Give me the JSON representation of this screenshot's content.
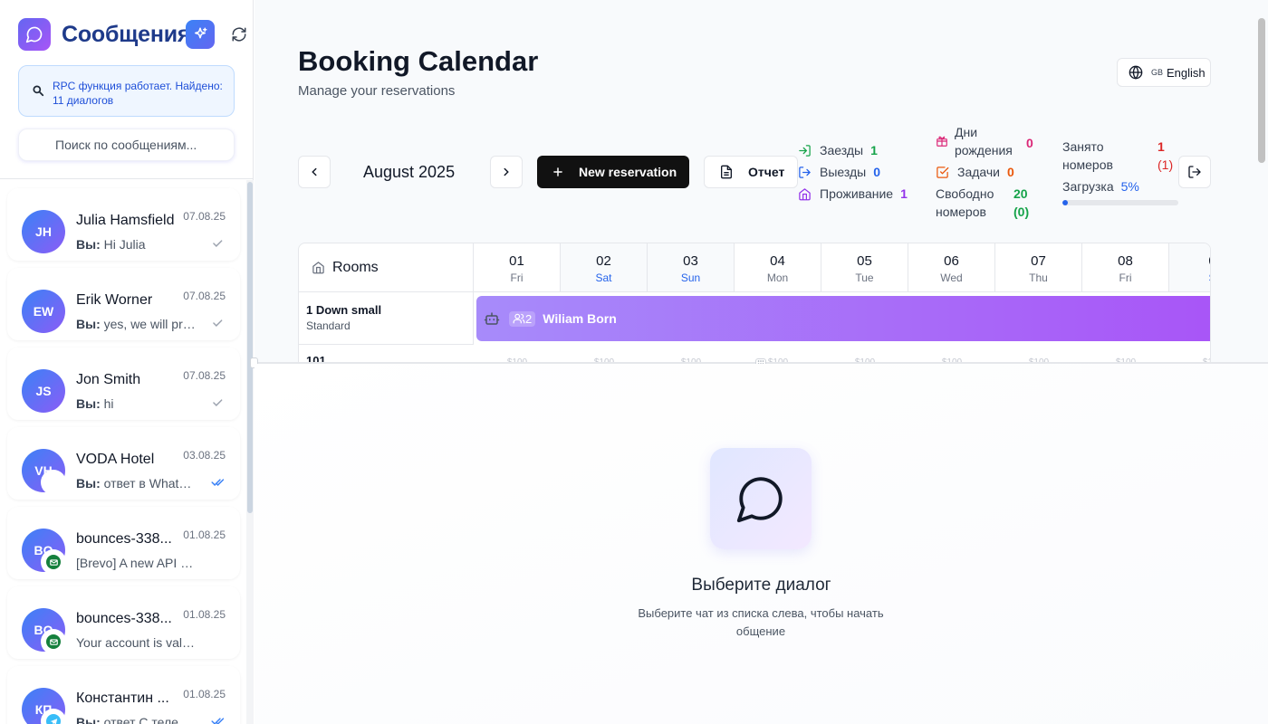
{
  "sidebar": {
    "app_title": "Сообщения",
    "rpc_status": "RPC функция работает. Найдено: 11 диалогов",
    "search_placeholder": "Поиск по сообщениям...",
    "chats": [
      {
        "initials": "JH",
        "name": "Julia Hamsfield",
        "date": "07.08.25",
        "sender": "Вы:",
        "preview": "Hi Julia",
        "status": "sent",
        "channel": ""
      },
      {
        "initials": "EW",
        "name": "Erik Worner",
        "date": "07.08.25",
        "sender": "Вы:",
        "preview": "yes, we will pro...",
        "status": "sent",
        "channel": ""
      },
      {
        "initials": "JS",
        "name": "Jon Smith",
        "date": "07.08.25",
        "sender": "Вы:",
        "preview": "hi",
        "status": "sent",
        "channel": ""
      },
      {
        "initials": "VH",
        "name": "VODA Hotel",
        "date": "03.08.25",
        "sender": "Вы:",
        "preview": "ответ в Whatsa...",
        "status": "read",
        "channel": "whatsapp"
      },
      {
        "initials": "BO",
        "name": "bounces-338...",
        "date": "01.08.25",
        "sender": "",
        "preview": "[Brevo] A new API k...",
        "status": "",
        "channel": "email"
      },
      {
        "initials": "BO",
        "name": "bounces-338...",
        "date": "01.08.25",
        "sender": "",
        "preview": "Your account is valid...",
        "status": "",
        "channel": "email"
      },
      {
        "initials": "КП",
        "name": "Константин ...",
        "date": "01.08.25",
        "sender": "Вы:",
        "preview": "ответ С телеги ...",
        "status": "read",
        "channel": "telegram"
      }
    ]
  },
  "booking": {
    "title": "Booking Calendar",
    "subtitle": "Manage your reservations",
    "language": {
      "flag": "GB",
      "label": "English"
    },
    "month": "August 2025",
    "new_reservation": "New reservation",
    "report": "Отчет",
    "stats": {
      "checkins": {
        "label": "Заезды",
        "value": "1"
      },
      "checkouts": {
        "label": "Выезды",
        "value": "0"
      },
      "staying": {
        "label": "Проживание",
        "value": "1"
      },
      "birthdays": {
        "label": "Дни рождения",
        "value": "0"
      },
      "tasks": {
        "label": "Задачи",
        "value": "0"
      },
      "free_rooms": {
        "label": "Свободно номеров",
        "value": "20",
        "extra": "(0)"
      },
      "occupied_rooms": {
        "label": "Занято номеров",
        "value": "1",
        "extra": "(1)"
      },
      "load": {
        "label": "Загрузка",
        "value": "5%",
        "fraction": 0.05
      }
    },
    "rooms_header": "Rooms",
    "days": [
      {
        "num": "01",
        "name": "Fri",
        "weekend": false
      },
      {
        "num": "02",
        "name": "Sat",
        "weekend": true
      },
      {
        "num": "03",
        "name": "Sun",
        "weekend": true
      },
      {
        "num": "04",
        "name": "Mon",
        "weekend": false
      },
      {
        "num": "05",
        "name": "Tue",
        "weekend": false
      },
      {
        "num": "06",
        "name": "Wed",
        "weekend": false
      },
      {
        "num": "07",
        "name": "Thu",
        "weekend": false
      },
      {
        "num": "08",
        "name": "Fri",
        "weekend": false
      },
      {
        "num": "0",
        "name": "S",
        "weekend": true
      }
    ],
    "rooms": [
      {
        "name": "1 Down small",
        "type": "Standard"
      },
      {
        "name": "101",
        "type": ""
      }
    ],
    "reservation": {
      "guests": "2",
      "guest_name": "Wiliam Born"
    },
    "price_label": "$100"
  },
  "empty_state": {
    "title": "Выберите диалог",
    "subtitle": "Выберите чат из списка слева, чтобы начать общение"
  },
  "colors": {
    "accent": "#6366f1",
    "checkin": "#16a34a",
    "checkout": "#2563eb",
    "staying": "#9333ea",
    "birthday": "#db2777",
    "tasks": "#ea580c",
    "occupied": "#dc2626",
    "reservation": "#a855f7"
  }
}
